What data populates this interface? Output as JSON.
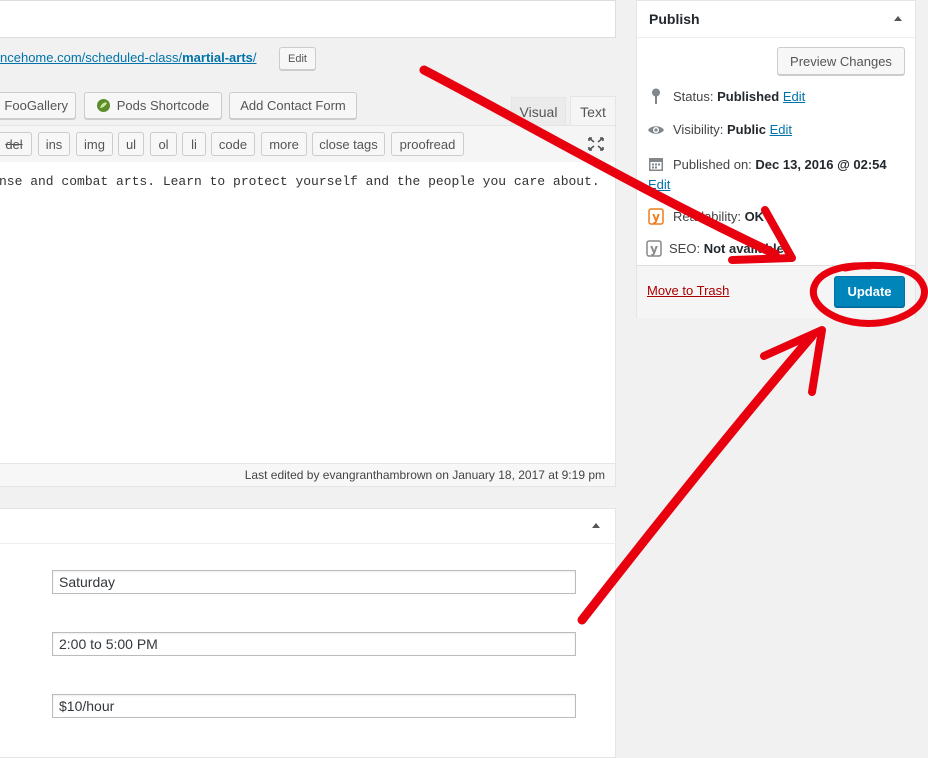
{
  "permalink": {
    "url_prefix": "ncehome.com/scheduled-class/",
    "url_slug": "martial-arts",
    "url_suffix": "/",
    "edit_label": "Edit"
  },
  "media_buttons": {
    "foogallery": "FooGallery",
    "pods": "Pods Shortcode",
    "contact": "Add Contact Form"
  },
  "editor_tabs": {
    "visual": "Visual",
    "text": "Text"
  },
  "quicktags": [
    "del",
    "ins",
    "img",
    "ul",
    "ol",
    "li",
    "code",
    "more",
    "close tags",
    "proofread"
  ],
  "editor": {
    "content": "nse and combat arts. Learn to protect yourself and the people you care about.",
    "last_edited": "Last edited by evangranthambrown on January 18, 2017 at 9:19 pm"
  },
  "fields": {
    "day": "Saturday",
    "time": "2:00 to 5:00 PM",
    "price": "$10/hour"
  },
  "publish": {
    "title": "Publish",
    "preview_label": "Preview Changes",
    "status_label": "Status:",
    "status_value": "Published",
    "visibility_label": "Visibility:",
    "visibility_value": "Public",
    "published_label": "Published on:",
    "published_value": "Dec 13, 2016 @ 02:54",
    "edit_label": "Edit",
    "readability_label": "Readability:",
    "readability_value": "OK",
    "seo_label": "SEO:",
    "seo_value": "Not available",
    "trash_label": "Move to Trash",
    "update_label": "Update"
  },
  "colors": {
    "accent": "#0073aa",
    "primary_button": "#0085ba",
    "trash_link": "#a00",
    "annotation": "#e8000f"
  }
}
